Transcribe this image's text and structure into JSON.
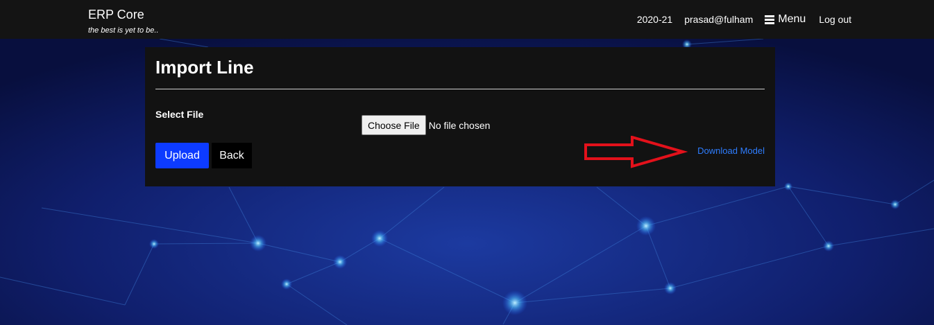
{
  "navbar": {
    "brand": "ERP Core",
    "tagline": "the best is yet to be..",
    "year": "2020-21",
    "user": "prasad@fulham",
    "menu_label": "Menu",
    "logout_label": "Log out"
  },
  "card": {
    "title": "Import Line",
    "select_file_label": "Select File",
    "choose_file_label": "Choose File",
    "file_status": "No file chosen",
    "upload_label": "Upload",
    "back_label": "Back",
    "download_label": "Download Model"
  },
  "colors": {
    "navbar_bg": "#141414",
    "card_bg": "#121212",
    "upload_bg": "#0d3bff",
    "link": "#2e7dff",
    "arrow": "#e3111b",
    "page_bg": "#0b1550"
  },
  "icons": [
    "menu-hamburger-icon",
    "red-arrow-annotation"
  ]
}
